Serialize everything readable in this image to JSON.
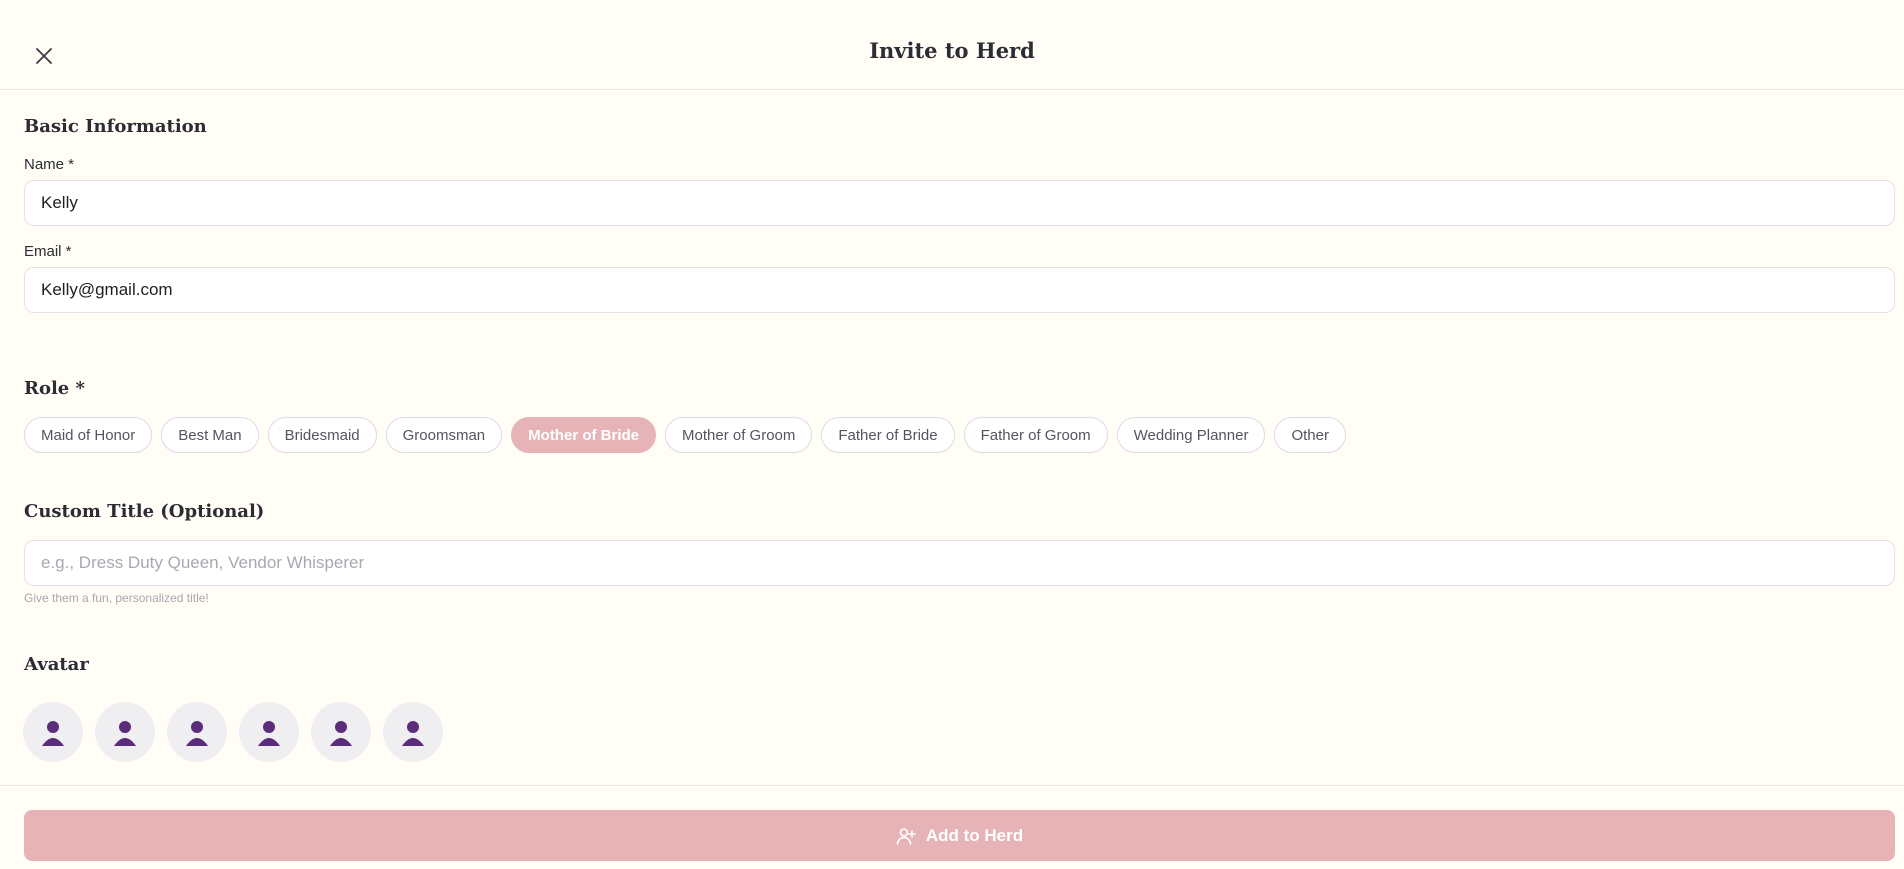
{
  "header": {
    "title": "Invite to Herd",
    "close_icon": "close-icon"
  },
  "basic_info": {
    "heading": "Basic Information",
    "name_label": "Name *",
    "name_value": "Kelly",
    "email_label": "Email *",
    "email_value": "Kelly@gmail.com"
  },
  "role": {
    "heading": "Role *",
    "options": [
      "Maid of Honor",
      "Best Man",
      "Bridesmaid",
      "Groomsman",
      "Mother of Bride",
      "Mother of Groom",
      "Father of Bride",
      "Father of Groom",
      "Wedding Planner",
      "Other"
    ],
    "selected": "Mother of Bride"
  },
  "custom_title": {
    "heading": "Custom Title (Optional)",
    "placeholder": "e.g., Dress Duty Queen, Vendor Whisperer",
    "value": "",
    "hint": "Give them a fun, personalized title!"
  },
  "avatar": {
    "heading": "Avatar",
    "options": [
      "person-icon",
      "person-icon",
      "person-icon",
      "person-icon",
      "person-icon",
      "person-icon"
    ]
  },
  "footer": {
    "add_label": "Add to Herd",
    "add_icon": "user-plus-icon"
  },
  "colors": {
    "background": "#fffdf5",
    "accent": "#e6b3b7",
    "avatar_figure": "#5b2c7a"
  }
}
